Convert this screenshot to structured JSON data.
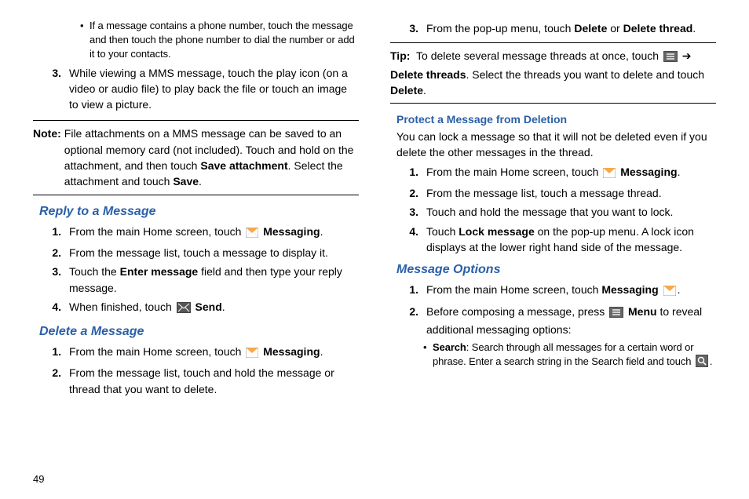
{
  "page_number": "49",
  "col1": {
    "bullet1": "If a message contains a phone number, touch the message and then touch the phone number to dial the number or add it to your contacts.",
    "step3": "While viewing a MMS message, touch the play icon (on a video or audio file) to play back the file or touch an image to view a picture.",
    "note_label": "Note:",
    "note_body_pre": "File attachments on a MMS message can be saved to an optional memory card (not included). Touch and hold on the attachment, and then touch ",
    "note_bold1": "Save attachment",
    "note_body_mid": ". Select the attachment and touch ",
    "note_bold2": "Save",
    "note_body_end": ".",
    "reply_heading": "Reply to a Message",
    "reply": {
      "s1a": "From the main Home screen, touch ",
      "s1b": "Messaging",
      "s1c": ".",
      "s2": "From the message list, touch a message to display it.",
      "s3a": "Touch the ",
      "s3b": "Enter message",
      "s3c": " field and then type your reply message.",
      "s4a": "When finished, touch ",
      "s4b": "Send",
      "s4c": "."
    },
    "delete_heading": "Delete a Message",
    "delete": {
      "s1a": "From the main Home screen, touch ",
      "s1b": "Messaging",
      "s1c": ".",
      "s2": "From the message list, touch and hold the message or thread that you want to delete."
    }
  },
  "col2": {
    "delete3a": "From the pop-up menu, touch ",
    "delete3b": "Delete",
    "delete3c": " or ",
    "delete3d": "Delete thread",
    "delete3e": ".",
    "tip_label": "Tip:",
    "tip_a": "To delete several message threads at once, touch ",
    "tip_arrow": " ➔ ",
    "tip_b": "Delete threads",
    "tip_c": ". Select the threads you want to delete and touch ",
    "tip_d": "Delete",
    "tip_e": ".",
    "protect_heading": "Protect a Message from Deletion",
    "protect_intro": "You can lock a message so that it will not be deleted even if you delete the other messages in the thread.",
    "protect": {
      "s1a": "From the main Home screen, touch ",
      "s1b": "Messaging",
      "s1c": ".",
      "s2": "From the message list, touch a message thread.",
      "s3": "Touch and hold the message that you want to lock.",
      "s4a": "Touch ",
      "s4b": "Lock message",
      "s4c": " on the pop-up menu. A lock icon displays at the lower right hand side of the message."
    },
    "options_heading": "Message Options",
    "options": {
      "s1a": "From the main Home screen, touch ",
      "s1b": "Messaging",
      "s1c": ".",
      "s2a": "Before composing a message, press ",
      "s2b": "Menu",
      "s2c": " to reveal additional messaging options:",
      "bullet_b": "Search",
      "bullet_text": ": Search through all messages for a certain word or phrase. Enter a search string in the Search field and touch "
    }
  },
  "nums": {
    "n1": "1.",
    "n2": "2.",
    "n3": "3.",
    "n4": "4."
  },
  "bullet": "•"
}
